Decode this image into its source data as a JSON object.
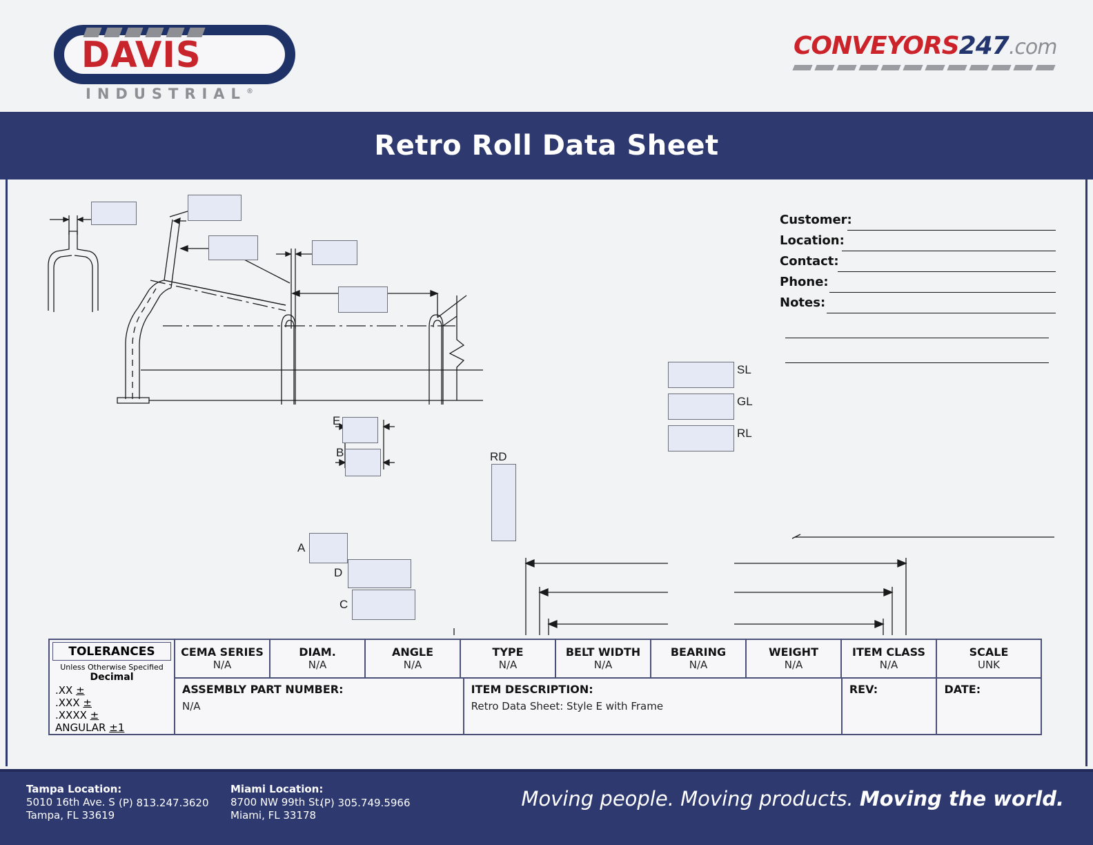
{
  "header": {
    "davis_logo": {
      "word": "DAVIS",
      "sub": "INDUSTRIAL",
      "registered": "®"
    },
    "conveyors_logo": {
      "part1": "CONVEYORS",
      "part2": "247",
      "part3": ".com"
    }
  },
  "title": "Retro Roll Data Sheet",
  "customer_form": {
    "fields": [
      {
        "label": "Customer:",
        "value": ""
      },
      {
        "label": "Location:",
        "value": ""
      },
      {
        "label": "Contact:",
        "value": ""
      },
      {
        "label": "Phone:",
        "value": ""
      },
      {
        "label": "Notes:",
        "value": ""
      }
    ],
    "extra_blank_lines": 2
  },
  "drawing": {
    "callouts": [
      {
        "id": "frame-gauge",
        "label": "",
        "value": ""
      },
      {
        "id": "roll-angle",
        "label": "",
        "value": ""
      },
      {
        "id": "trough-dim",
        "label": "",
        "value": ""
      },
      {
        "id": "mount-dim",
        "label": "",
        "value": ""
      },
      {
        "id": "center-dim",
        "label": "",
        "value": ""
      }
    ],
    "detail_labels": [
      "E",
      "B",
      "A",
      "D",
      "C"
    ],
    "roller_dims": [
      {
        "label": "SL",
        "value": ""
      },
      {
        "label": "GL",
        "value": ""
      },
      {
        "label": "RL",
        "value": ""
      },
      {
        "label": "RD",
        "value": ""
      }
    ]
  },
  "spec_table": {
    "tolerances": {
      "title": "TOLERANCES",
      "subtitle": "Unless Otherwise Specified",
      "decimal_label": "Decimal",
      "rows": [
        ".XX ",
        ".XXX ",
        ".XXXX ",
        "ANGULAR "
      ],
      "plusminus": "±1",
      "pm": "±"
    },
    "columns": [
      {
        "header": "CEMA SERIES",
        "value": "N/A"
      },
      {
        "header": "DIAM.",
        "value": "N/A"
      },
      {
        "header": "ANGLE",
        "value": "N/A"
      },
      {
        "header": "TYPE",
        "value": "N/A"
      },
      {
        "header": "BELT WIDTH",
        "value": "N/A"
      },
      {
        "header": "BEARING",
        "value": "N/A"
      },
      {
        "header": "WEIGHT",
        "value": "N/A"
      },
      {
        "header": "ITEM CLASS",
        "value": "N/A"
      },
      {
        "header": "SCALE",
        "value": "UNK"
      }
    ],
    "bottom": [
      {
        "header": "ASSEMBLY PART NUMBER:",
        "value": "N/A"
      },
      {
        "header": "ITEM DESCRIPTION:",
        "value": "Retro Data Sheet: Style E with Frame"
      },
      {
        "header": "REV:",
        "value": ""
      },
      {
        "header": "DATE:",
        "value": ""
      }
    ]
  },
  "footer": {
    "tampa": {
      "title": "Tampa Location:",
      "address1": "5010 16th Ave. S",
      "address2": "Tampa, FL 33619",
      "phone": "(P) 813.247.3620"
    },
    "miami": {
      "title": "Miami Location:",
      "address1": "8700 NW 99th St.",
      "address2": "Miami, FL 33178",
      "phone": "(P) 305.749.5966"
    },
    "tagline_light": "Moving people. Moving products. ",
    "tagline_bold": "Moving the world."
  },
  "colors": {
    "navy": "#2e3970",
    "red": "#cc2229",
    "gray": "#8d8f94",
    "callout_fill": "#e4e9f5"
  }
}
